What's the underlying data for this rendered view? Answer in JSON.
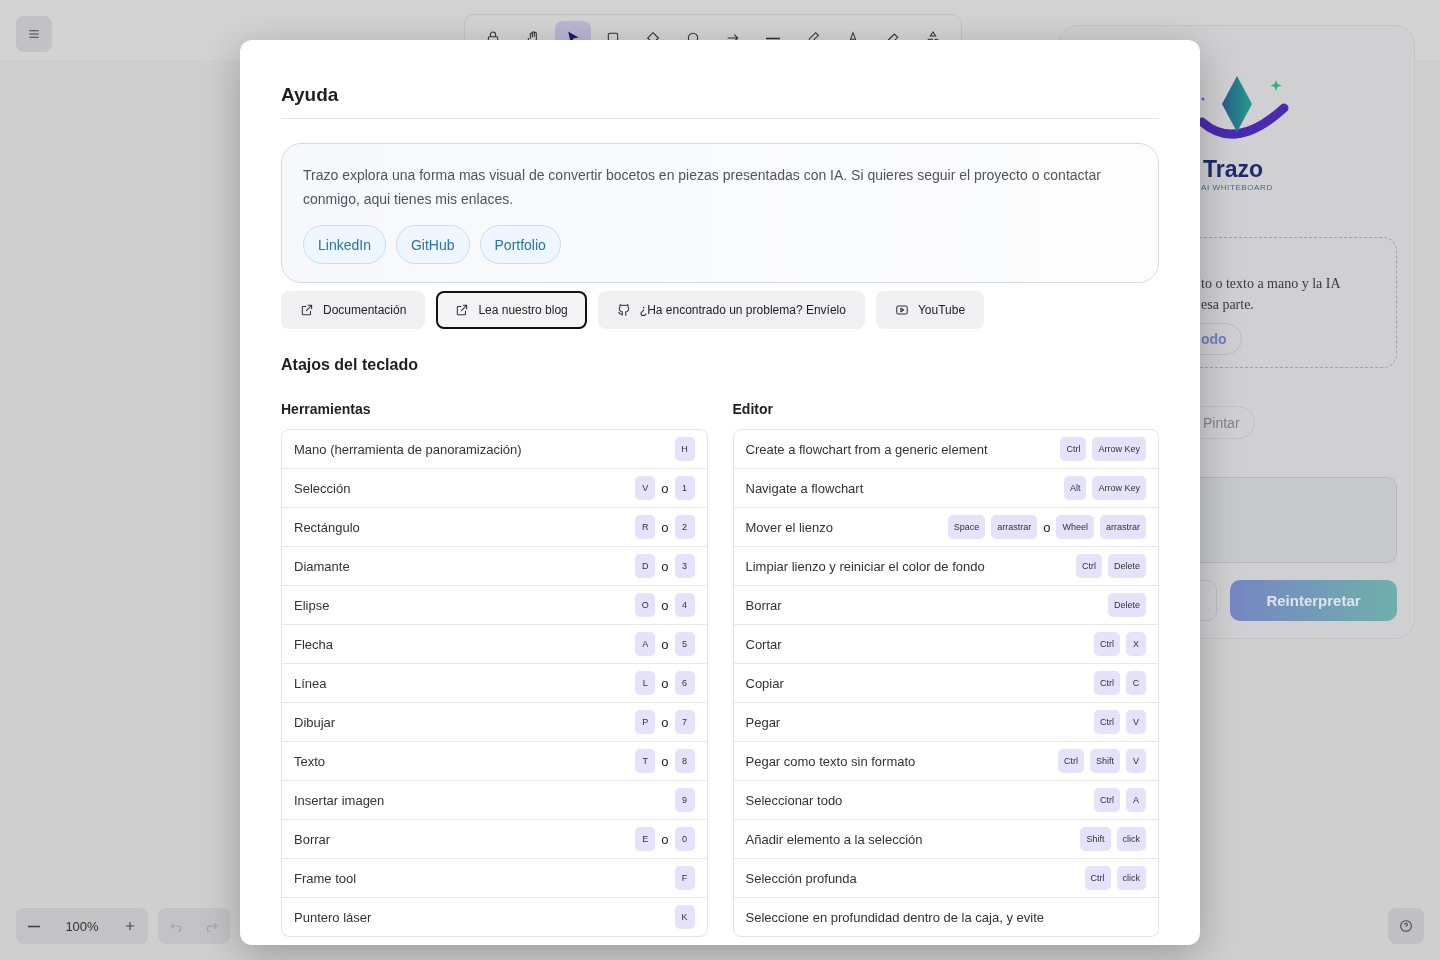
{
  "toolbar": {
    "tools": [
      {
        "kind": "lock",
        "selected": false
      },
      {
        "kind": "hand",
        "selected": false
      },
      {
        "kind": "pointer",
        "selected": true
      },
      {
        "kind": "rectangle",
        "selected": false
      },
      {
        "kind": "diamond",
        "selected": false
      },
      {
        "kind": "ellipse",
        "selected": false
      },
      {
        "kind": "arrow",
        "selected": false
      },
      {
        "kind": "line",
        "selected": false
      },
      {
        "kind": "pencil",
        "selected": false
      },
      {
        "kind": "text",
        "selected": false
      },
      {
        "kind": "eraser",
        "selected": false
      },
      {
        "kind": "shapes",
        "selected": false
      }
    ]
  },
  "zoom": {
    "value": "100%"
  },
  "side_panel": {
    "logo_title": "Trazo",
    "logo_subtitle": "AI WHITEBOARD",
    "hint_lines": [
      "to o texto a mano y la IA",
      "esa parte."
    ],
    "mode_button": "odo",
    "paint_button": "Pintar",
    "submit_button": "Reinterpretar"
  },
  "dialog": {
    "title": "Ayuda",
    "intro": "Trazo explora una forma mas visual de convertir bocetos en piezas presentadas con IA. Si quieres seguir el proyecto o contactar conmigo, aqui tienes mis enlaces.",
    "links": [
      "LinkedIn",
      "GitHub",
      "Portfolio"
    ],
    "actions": [
      {
        "kind": "external",
        "label": "Documentación",
        "focused": false
      },
      {
        "kind": "external",
        "label": "Lea nuestro blog",
        "focused": true
      },
      {
        "kind": "github",
        "label": "¿Ha encontrado un problema? Envíelo",
        "focused": false
      },
      {
        "kind": "youtube",
        "label": "YouTube",
        "focused": false
      }
    ],
    "shortcuts_title": "Atajos del teclado",
    "sections": [
      {
        "title": "Herramientas",
        "rows": [
          {
            "label": "Mano (herramienta de panoramización)",
            "keys": [
              {
                "kind": "key",
                "text": "H"
              }
            ]
          },
          {
            "label": "Selección",
            "keys": [
              {
                "kind": "key",
                "text": "V"
              },
              {
                "kind": "or",
                "text": "o"
              },
              {
                "kind": "key",
                "text": "1"
              }
            ]
          },
          {
            "label": "Rectángulo",
            "keys": [
              {
                "kind": "key",
                "text": "R"
              },
              {
                "kind": "or",
                "text": "o"
              },
              {
                "kind": "key",
                "text": "2"
              }
            ]
          },
          {
            "label": "Diamante",
            "keys": [
              {
                "kind": "key",
                "text": "D"
              },
              {
                "kind": "or",
                "text": "o"
              },
              {
                "kind": "key",
                "text": "3"
              }
            ]
          },
          {
            "label": "Elipse",
            "keys": [
              {
                "kind": "key",
                "text": "O"
              },
              {
                "kind": "or",
                "text": "o"
              },
              {
                "kind": "key",
                "text": "4"
              }
            ]
          },
          {
            "label": "Flecha",
            "keys": [
              {
                "kind": "key",
                "text": "A"
              },
              {
                "kind": "or",
                "text": "o"
              },
              {
                "kind": "key",
                "text": "5"
              }
            ]
          },
          {
            "label": "Línea",
            "keys": [
              {
                "kind": "key",
                "text": "L"
              },
              {
                "kind": "or",
                "text": "o"
              },
              {
                "kind": "key",
                "text": "6"
              }
            ]
          },
          {
            "label": "Dibujar",
            "keys": [
              {
                "kind": "key",
                "text": "P"
              },
              {
                "kind": "or",
                "text": "o"
              },
              {
                "kind": "key",
                "text": "7"
              }
            ]
          },
          {
            "label": "Texto",
            "keys": [
              {
                "kind": "key",
                "text": "T"
              },
              {
                "kind": "or",
                "text": "o"
              },
              {
                "kind": "key",
                "text": "8"
              }
            ]
          },
          {
            "label": "Insertar imagen",
            "keys": [
              {
                "kind": "key",
                "text": "9"
              }
            ]
          },
          {
            "label": "Borrar",
            "keys": [
              {
                "kind": "key",
                "text": "E"
              },
              {
                "kind": "or",
                "text": "o"
              },
              {
                "kind": "key",
                "text": "0"
              }
            ]
          },
          {
            "label": "Frame tool",
            "keys": [
              {
                "kind": "key",
                "text": "F"
              }
            ]
          },
          {
            "label": "Puntero láser",
            "keys": [
              {
                "kind": "key",
                "text": "K"
              }
            ]
          }
        ]
      },
      {
        "title": "Editor",
        "rows": [
          {
            "label": "Create a flowchart from a generic element",
            "keys": [
              {
                "kind": "key",
                "text": "Ctrl"
              },
              {
                "kind": "key",
                "text": "Arrow Key"
              }
            ]
          },
          {
            "label": "Navigate a flowchart",
            "keys": [
              {
                "kind": "key",
                "text": "Alt"
              },
              {
                "kind": "key",
                "text": "Arrow Key"
              }
            ]
          },
          {
            "label": "Mover el lienzo",
            "keys": [
              {
                "kind": "key",
                "text": "Space"
              },
              {
                "kind": "key",
                "text": "arrastrar"
              },
              {
                "kind": "or",
                "text": "o"
              },
              {
                "kind": "key",
                "text": "Wheel"
              },
              {
                "kind": "key",
                "text": "arrastrar"
              }
            ]
          },
          {
            "label": "Limpiar lienzo y reiniciar el color de fondo",
            "keys": [
              {
                "kind": "key",
                "text": "Ctrl"
              },
              {
                "kind": "key",
                "text": "Delete"
              }
            ]
          },
          {
            "label": "Borrar",
            "keys": [
              {
                "kind": "key",
                "text": "Delete"
              }
            ]
          },
          {
            "label": "Cortar",
            "keys": [
              {
                "kind": "key",
                "text": "Ctrl"
              },
              {
                "kind": "key",
                "text": "X"
              }
            ]
          },
          {
            "label": "Copiar",
            "keys": [
              {
                "kind": "key",
                "text": "Ctrl"
              },
              {
                "kind": "key",
                "text": "C"
              }
            ]
          },
          {
            "label": "Pegar",
            "keys": [
              {
                "kind": "key",
                "text": "Ctrl"
              },
              {
                "kind": "key",
                "text": "V"
              }
            ]
          },
          {
            "label": "Pegar como texto sin formato",
            "keys": [
              {
                "kind": "key",
                "text": "Ctrl"
              },
              {
                "kind": "key",
                "text": "Shift"
              },
              {
                "kind": "key",
                "text": "V"
              }
            ]
          },
          {
            "label": "Seleccionar todo",
            "keys": [
              {
                "kind": "key",
                "text": "Ctrl"
              },
              {
                "kind": "key",
                "text": "A"
              }
            ]
          },
          {
            "label": "Añadir elemento a la selección",
            "keys": [
              {
                "kind": "key",
                "text": "Shift"
              },
              {
                "kind": "key",
                "text": "click"
              }
            ]
          },
          {
            "label": "Selección profunda",
            "keys": [
              {
                "kind": "key",
                "text": "Ctrl"
              },
              {
                "kind": "key",
                "text": "click"
              }
            ]
          },
          {
            "label": "Seleccione en profundidad dentro de la caja, y evite",
            "keys": []
          }
        ]
      }
    ]
  }
}
